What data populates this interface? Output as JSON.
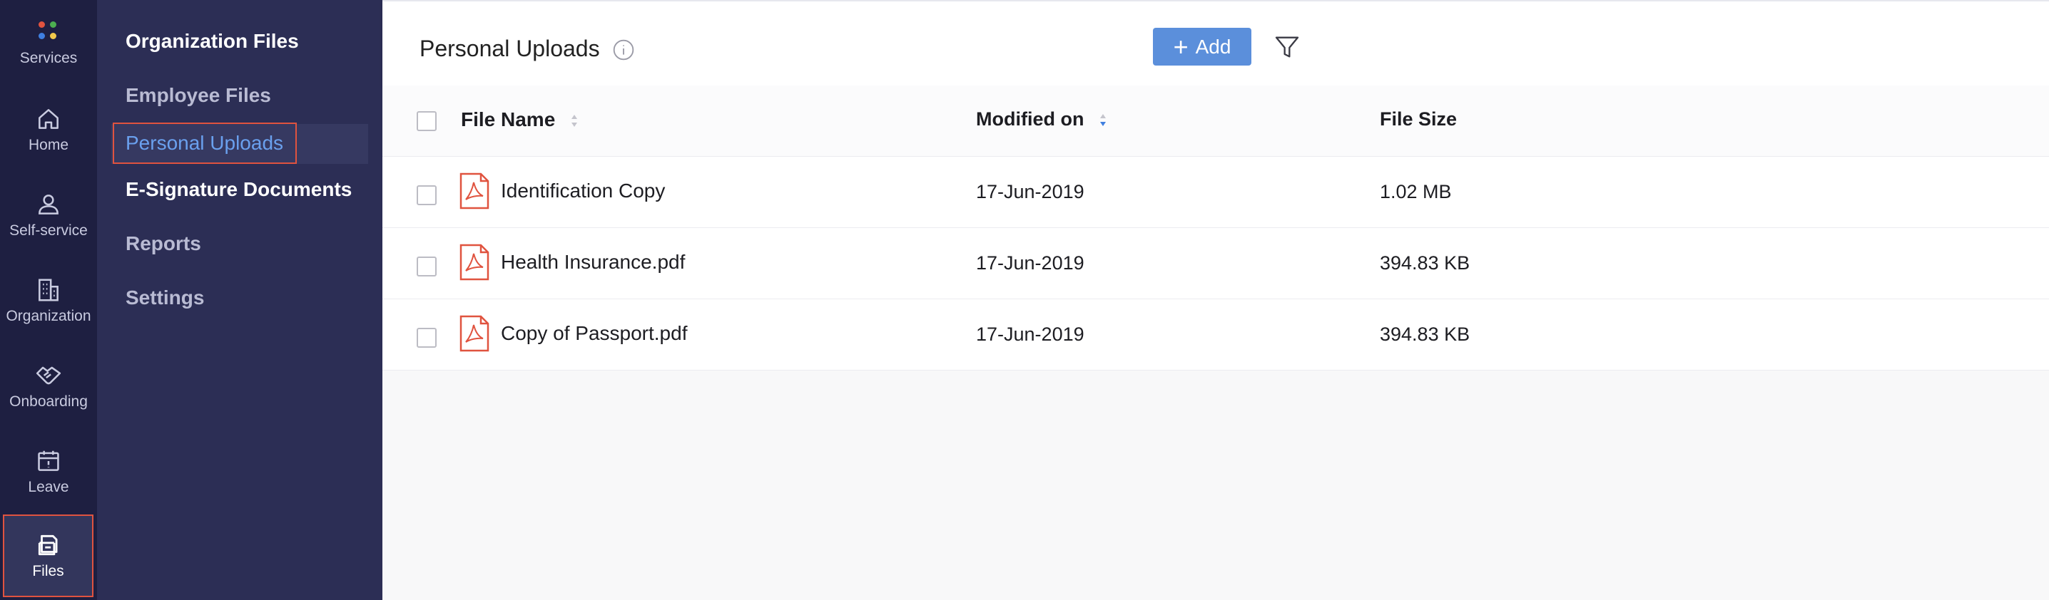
{
  "rail": {
    "items": [
      {
        "label": "Services"
      },
      {
        "label": "Home"
      },
      {
        "label": "Self-service"
      },
      {
        "label": "Organization"
      },
      {
        "label": "Onboarding"
      },
      {
        "label": "Leave"
      },
      {
        "label": "Files"
      }
    ],
    "active": "Files"
  },
  "subnav": {
    "items": [
      {
        "label": "Organization Files"
      },
      {
        "label": "Employee Files"
      },
      {
        "label": "Personal Uploads"
      },
      {
        "label": "E-Signature Documents"
      },
      {
        "label": "Reports"
      },
      {
        "label": "Settings"
      }
    ],
    "active": "Personal Uploads"
  },
  "header": {
    "title": "Personal Uploads",
    "add_label": "Add"
  },
  "table": {
    "columns": [
      "File Name",
      "Modified on",
      "File Size"
    ],
    "rows": [
      {
        "name": "Identification Copy",
        "modified": "17-Jun-2019",
        "size": "1.02 MB"
      },
      {
        "name": "Health Insurance.pdf",
        "modified": "17-Jun-2019",
        "size": "394.83 KB"
      },
      {
        "name": "Copy of Passport.pdf",
        "modified": "17-Jun-2019",
        "size": "394.83 KB"
      }
    ]
  },
  "icons": {
    "services": "services-dots-icon",
    "home": "home-icon",
    "self_service": "user-icon",
    "organization": "building-icon",
    "onboarding": "handshake-icon",
    "leave": "calendar-icon",
    "files": "files-icon",
    "info": "info-icon",
    "filter": "filter-icon",
    "pdf": "pdf-file-icon"
  },
  "colors": {
    "rail_bg": "#1e1f41",
    "subnav_bg": "#2c2e55",
    "accent": "#5b8fdb",
    "highlight_border": "#e0533f",
    "pdf_red": "#e0533f"
  }
}
